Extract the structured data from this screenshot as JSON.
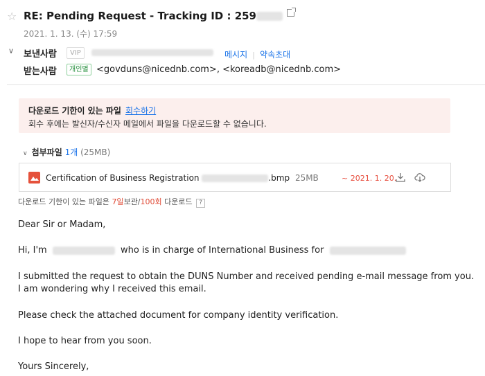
{
  "header": {
    "subject_prefix": "RE: Pending Request - Tracking ID : 259",
    "date": "2021. 1. 13. (수) 17:59"
  },
  "sender": {
    "label": "보낸사람",
    "vip_badge": "VIP",
    "message_link": "메시지",
    "schedule_link": "약속초대"
  },
  "recipients": {
    "label": "받는사람",
    "badge": "개인별",
    "addresses": "<govduns@nicednb.com>, <koreadb@nicednb.com>"
  },
  "notice": {
    "title": "다운로드 기한이 있는 파일",
    "recall_link": "회수하기",
    "body": "회수 후에는 발신자/수신자 메일에서 파일을 다운로드할 수 없습니다."
  },
  "attachments": {
    "label": "첨부파일",
    "count": "1개",
    "total_size": "(25MB)",
    "file": {
      "name_prefix": "Certification of Business Registration",
      "extension": ".bmp",
      "size": "25MB",
      "expiry": "~ 2021. 1. 20."
    },
    "info_prefix": "다운로드 기한이 있는 파일은",
    "retention_days": "7일",
    "retention_suffix": "보관/",
    "download_limit": "100회",
    "download_suffix": "다운로드",
    "help": "?"
  },
  "body": {
    "greeting": "Dear Sir or Madam,",
    "hi_prefix": "Hi, I'm",
    "hi_middle": "who is in charge of International Business for",
    "line1": "I submitted the request to obtain the DUNS Number and received pending e-mail message from you.",
    "line2": "I am wondering why I received this email.",
    "line3": "Please check the attached document for company identity verification.",
    "line4": "I hope to hear from you soon.",
    "closing": "Yours Sincerely,"
  },
  "colors": {
    "link": "#1a73e8",
    "notice_bg": "#fcefed",
    "file_icon": "#e5513b",
    "alert_red": "#e04a36"
  },
  "icons": [
    "star-icon",
    "external-link-icon",
    "chevron-down-icon",
    "image-file-icon",
    "download-icon",
    "cloud-download-icon",
    "help-icon"
  ]
}
